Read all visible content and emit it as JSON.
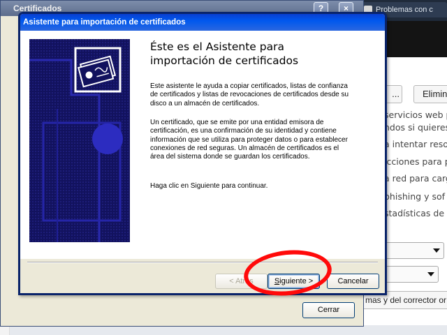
{
  "background_browser": {
    "tab_title": "Problemas con c",
    "dots_button": "...",
    "delete_button": "Elimin",
    "lines": [
      "servicios web p",
      "ndos si quieres.",
      "a intentar reso",
      "icciones para p",
      "a red para carg",
      "phishing y sof",
      "stadísticas de"
    ],
    "language_button": "mas y del corrector or"
  },
  "certificates_window": {
    "title": "Certificados",
    "close_button": "Cerrar",
    "caption_buttons": {
      "help": "?",
      "close": "×"
    }
  },
  "wizard": {
    "title": "Asistente para importación de certificados",
    "heading_line1": "Éste es el Asistente para",
    "heading_line2": "importación de certificados",
    "paragraph1": "Este asistente le ayuda a copiar certificados, listas de confianza de certificados y listas de revocaciones de certificados desde su disco a un almacén de certificados.",
    "paragraph2": "Un certificado, que se emite por una entidad emisora de certificación, es una confirmación de su identidad y contiene información que se utiliza para proteger datos o para establecer conexiones de red seguras. Un almacén de certificados es el área del sistema donde se guardan los certificados.",
    "paragraph3": "Haga clic en Siguiente para continuar.",
    "buttons": {
      "back": "< Atrás",
      "next_mnemonic": "S",
      "next_rest": "iguiente >",
      "cancel": "Cancelar"
    }
  },
  "colors": {
    "xp_title_blue": "#0058ee",
    "wizard_image_navy": "#12125e",
    "annotation_red": "#ff0a0a"
  },
  "icons": [
    "certificate-icon",
    "help-icon",
    "close-icon"
  ]
}
